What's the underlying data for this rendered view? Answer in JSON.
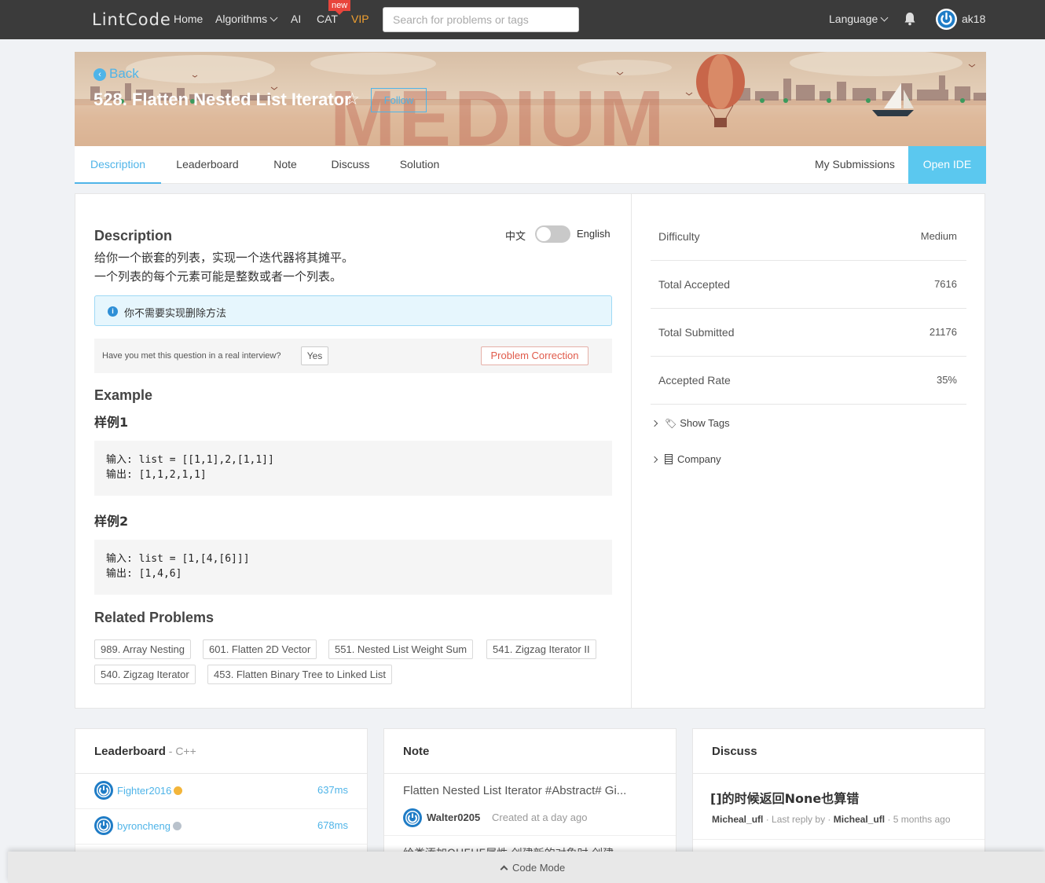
{
  "nav": {
    "logo": "LintCode",
    "home": "Home",
    "algorithms": "Algorithms",
    "ai": "AI",
    "cat": "CAT",
    "new_badge": "new",
    "vip": "VIP",
    "search_placeholder": "Search for problems or tags",
    "language": "Language",
    "username": "ak18"
  },
  "banner": {
    "back": "Back",
    "title": "528. Flatten Nested List Iterator",
    "follow": "Follow",
    "difficulty_watermark": "MEDIUM"
  },
  "tabs": [
    "Description",
    "Leaderboard",
    "Note",
    "Discuss",
    "Solution"
  ],
  "tabs_right": {
    "my_submissions": "My Submissions",
    "open_ide": "Open IDE"
  },
  "description": {
    "heading": "Description",
    "toggle_cn": "中文",
    "toggle_en": "English",
    "line1": "给你一个嵌套的列表，实现一个迭代器将其摊平。",
    "line2": "一个列表的每个元素可能是整数或者一个列表。",
    "notice": "你不需要实现删除方法",
    "interview_q": "Have you met this question in a real interview?",
    "yes": "Yes",
    "problem_correction": "Problem Correction",
    "example_heading": "Example",
    "example1_title": "样例1",
    "example1_in": "输入: list = [[1,1],2,[1,1]]",
    "example1_out": "输出: [1,1,2,1,1]",
    "example2_title": "样例2",
    "example2_in": "输入: list = [1,[4,[6]]]",
    "example2_out": "输出: [1,4,6]",
    "related_heading": "Related Problems",
    "related": [
      "989. Array Nesting",
      "601. Flatten 2D Vector",
      "551. Nested List Weight Sum",
      "541. Zigzag Iterator II",
      "540. Zigzag Iterator",
      "453. Flatten Binary Tree to Linked List"
    ]
  },
  "stats": [
    {
      "label": "Difficulty",
      "value": "Medium"
    },
    {
      "label": "Total Accepted",
      "value": "7616"
    },
    {
      "label": "Total Submitted",
      "value": "21176"
    },
    {
      "label": "Accepted Rate",
      "value": "35%"
    }
  ],
  "expanders": {
    "tags": "Show Tags",
    "company": "Company"
  },
  "leaderboard": {
    "title": "Leaderboard",
    "lang": "C++",
    "rows": [
      {
        "name": "Fighter2016",
        "time": "637ms",
        "medal_color": "#f3b53a"
      },
      {
        "name": "byroncheng",
        "time": "678ms",
        "medal_color": "#b9c2cc"
      }
    ]
  },
  "note": {
    "title": "Note",
    "item_title": "Flatten Nested List Iterator #Abstract# Gi...",
    "author": "Walter0205",
    "created": "Created at a day ago",
    "preview": "给类添加QUEUE属性 创建新的对象时 创建"
  },
  "discuss": {
    "title": "Discuss",
    "topic": "[]的时候返回None也算错",
    "author": "Micheal_ufl",
    "last_reply_by": "· Last reply by ·",
    "last_replier": "Micheal_ufl",
    "ago": "· 5 months ago"
  },
  "code_mode": "Code Mode",
  "colors": {
    "accent": "#4fb4e8",
    "open_ide": "#5bc8ef",
    "nav_bg": "#3b3b3b",
    "vip": "#f0a030"
  }
}
